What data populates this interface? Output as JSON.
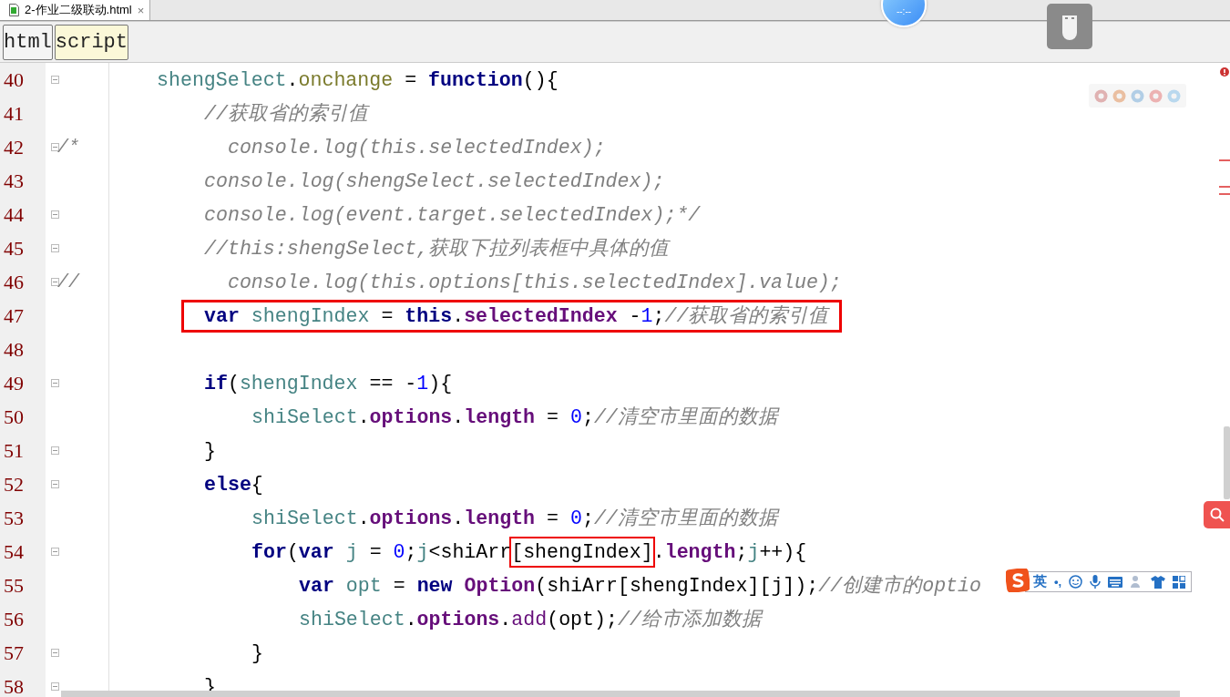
{
  "tabs": [
    {
      "label": "2-作业二级联动.html",
      "close": "×",
      "selected": true
    }
  ],
  "breadcrumbs": [
    {
      "label": "html",
      "selected": false
    },
    {
      "label": "script",
      "selected": true
    }
  ],
  "clock": "--:--",
  "lines": [
    {
      "num": "40",
      "fold": true,
      "boxed": false,
      "tokens": [
        {
          "kind": "var",
          "text": "shengSelect"
        },
        {
          "kind": "plain",
          "text": "."
        },
        {
          "kind": "event",
          "text": "onchange"
        },
        {
          "kind": "plain",
          "text": " = "
        },
        {
          "kind": "kw",
          "text": "function"
        },
        {
          "kind": "plain",
          "text": "(){"
        }
      ],
      "children": [
        {
          "num": "41",
          "fold": false,
          "boxed": false,
          "tokens": [
            {
              "kind": "comment",
              "text": "//获取省的索引值"
            }
          ]
        },
        {
          "num": "42",
          "fold": true,
          "gutter": "/*",
          "boxed": false,
          "tokens": [
            {
              "kind": "comment",
              "text": "  console.log(this.selectedIndex);"
            }
          ]
        },
        {
          "num": "43",
          "fold": false,
          "boxed": false,
          "tokens": [
            {
              "kind": "comment",
              "text": "console.log(shengSelect.selectedIndex);"
            }
          ]
        },
        {
          "num": "44",
          "fold": true,
          "boxed": false,
          "tokens": [
            {
              "kind": "comment",
              "text": "console.log(event.target.selectedIndex);*/"
            }
          ]
        },
        {
          "num": "45",
          "fold": true,
          "boxed": false,
          "tokens": [
            {
              "kind": "comment",
              "text": "//this:shengSelect,获取下拉列表框中具体的值"
            }
          ]
        },
        {
          "num": "46",
          "fold": true,
          "gutter": "//",
          "boxed": false,
          "tokens": [
            {
              "kind": "comment",
              "text": "  console.log(this.options[this.selectedIndex].value);"
            }
          ]
        },
        {
          "num": "47",
          "fold": false,
          "boxed": true,
          "tokens": [
            {
              "kind": "kw",
              "text": "var "
            },
            {
              "kind": "var",
              "text": "shengIndex"
            },
            {
              "kind": "plain",
              "text": " = "
            },
            {
              "kind": "kw",
              "text": "this"
            },
            {
              "kind": "plain",
              "text": "."
            },
            {
              "kind": "prop",
              "text": "selectedIndex"
            },
            {
              "kind": "plain",
              "text": " -"
            },
            {
              "kind": "num",
              "text": "1"
            },
            {
              "kind": "plain",
              "text": ";"
            },
            {
              "kind": "comment",
              "text": "//获取省的索引值"
            }
          ]
        },
        {
          "num": "48",
          "fold": false
        },
        {
          "num": "49",
          "fold": true,
          "boxed": false,
          "tokens": [
            {
              "kind": "kw",
              "text": "if"
            },
            {
              "kind": "plain",
              "text": "("
            },
            {
              "kind": "var",
              "text": "shengIndex"
            },
            {
              "kind": "plain",
              "text": " == -"
            },
            {
              "kind": "num",
              "text": "1"
            },
            {
              "kind": "plain",
              "text": "){"
            }
          ],
          "children": [
            {
              "num": "50",
              "fold": false,
              "boxed": false,
              "tokens": [
                {
                  "kind": "var",
                  "text": "shiSelect"
                },
                {
                  "kind": "plain",
                  "text": "."
                },
                {
                  "kind": "prop",
                  "text": "options"
                },
                {
                  "kind": "plain",
                  "text": "."
                },
                {
                  "kind": "prop",
                  "text": "length"
                },
                {
                  "kind": "plain",
                  "text": " = "
                },
                {
                  "kind": "num",
                  "text": "0"
                },
                {
                  "kind": "plain",
                  "text": ";"
                },
                {
                  "kind": "comment",
                  "text": "//清空市里面的数据"
                }
              ]
            }
          ]
        },
        {
          "num": "51",
          "fold": true,
          "boxed": false,
          "tokens": [
            {
              "kind": "plain",
              "text": "}"
            }
          ]
        },
        {
          "num": "52",
          "fold": true,
          "boxed": false,
          "tokens": [
            {
              "kind": "kw",
              "text": "else"
            },
            {
              "kind": "plain",
              "text": "{"
            }
          ],
          "children": [
            {
              "num": "53",
              "fold": false,
              "boxed": false,
              "tokens": [
                {
                  "kind": "var",
                  "text": "shiSelect"
                },
                {
                  "kind": "plain",
                  "text": "."
                },
                {
                  "kind": "prop",
                  "text": "options"
                },
                {
                  "kind": "plain",
                  "text": "."
                },
                {
                  "kind": "prop",
                  "text": "length"
                },
                {
                  "kind": "plain",
                  "text": " = "
                },
                {
                  "kind": "num",
                  "text": "0"
                },
                {
                  "kind": "plain",
                  "text": ";"
                },
                {
                  "kind": "comment",
                  "text": "//清空市里面的数据"
                }
              ]
            },
            {
              "num": "54",
              "fold": true,
              "boxed": false,
              "tokens": [
                {
                  "kind": "kw",
                  "text": "for"
                },
                {
                  "kind": "plain",
                  "text": "("
                },
                {
                  "kind": "kw",
                  "text": "var "
                },
                {
                  "kind": "var",
                  "text": "j"
                },
                {
                  "kind": "plain",
                  "text": " = "
                },
                {
                  "kind": "num",
                  "text": "0"
                },
                {
                  "kind": "plain",
                  "text": ";"
                },
                {
                  "kind": "var",
                  "text": "j"
                },
                {
                  "kind": "plain",
                  "text": "<shiArr"
                },
                {
                  "kind": "plain",
                  "text": "[shengIndex]",
                  "boxed": true
                },
                {
                  "kind": "plain",
                  "text": "."
                },
                {
                  "kind": "prop",
                  "text": "length"
                },
                {
                  "kind": "plain",
                  "text": ";"
                },
                {
                  "kind": "var",
                  "text": "j"
                },
                {
                  "kind": "plain",
                  "text": "++){"
                }
              ],
              "children": [
                {
                  "num": "55",
                  "fold": false,
                  "boxed": false,
                  "tokens": [
                    {
                      "kind": "kw",
                      "text": "var "
                    },
                    {
                      "kind": "var",
                      "text": "opt"
                    },
                    {
                      "kind": "plain",
                      "text": " = "
                    },
                    {
                      "kind": "kw",
                      "text": "new "
                    },
                    {
                      "kind": "cls",
                      "text": "Option"
                    },
                    {
                      "kind": "plain",
                      "text": "(shiArr[shengIndex][j]);"
                    },
                    {
                      "kind": "comment",
                      "text": "//创建市的optio"
                    }
                  ]
                },
                {
                  "num": "56",
                  "fold": false,
                  "boxed": false,
                  "tokens": [
                    {
                      "kind": "var",
                      "text": "shiSelect"
                    },
                    {
                      "kind": "plain",
                      "text": "."
                    },
                    {
                      "kind": "prop",
                      "text": "options"
                    },
                    {
                      "kind": "plain",
                      "text": "."
                    },
                    {
                      "kind": "method",
                      "text": "add"
                    },
                    {
                      "kind": "plain",
                      "text": "(opt);"
                    },
                    {
                      "kind": "comment",
                      "text": "//给市添加数据"
                    }
                  ]
                }
              ]
            },
            {
              "num": "57",
              "fold": true,
              "boxed": false,
              "tokens": [
                {
                  "kind": "plain",
                  "text": "}"
                }
              ]
            }
          ]
        },
        {
          "num": "58",
          "fold": true,
          "boxed": false,
          "tokens": [
            {
              "kind": "plain",
              "text": "}"
            }
          ]
        }
      ]
    }
  ],
  "ime": {
    "language": "英",
    "punct": "•,"
  }
}
